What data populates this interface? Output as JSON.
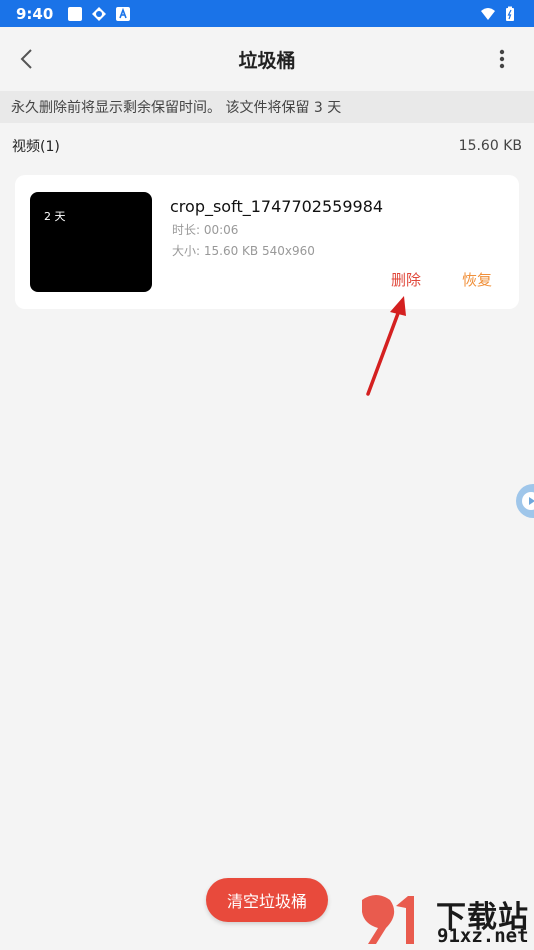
{
  "status_bar": {
    "time": "9:40"
  },
  "header": {
    "title": "垃圾桶"
  },
  "notice": {
    "text": "永久删除前将显示剩余保留时间。 该文件将保留 3 天"
  },
  "section": {
    "label": "视频(1)",
    "total_size": "15.60 KB"
  },
  "file": {
    "thumb_badge": "2 天",
    "name": "crop_soft_1747702559984",
    "duration": "时长: 00:06",
    "size": "大小: 15.60 KB 540x960",
    "delete_label": "删除",
    "restore_label": "恢复"
  },
  "footer": {
    "empty_label": "清空垃圾桶"
  },
  "watermark": {
    "cn": "下载站",
    "url": "91xz.net"
  },
  "colors": {
    "status_bar": "#1a73e8",
    "delete": "#e0483b",
    "restore": "#f0903a",
    "empty_button": "#e84a3c"
  }
}
